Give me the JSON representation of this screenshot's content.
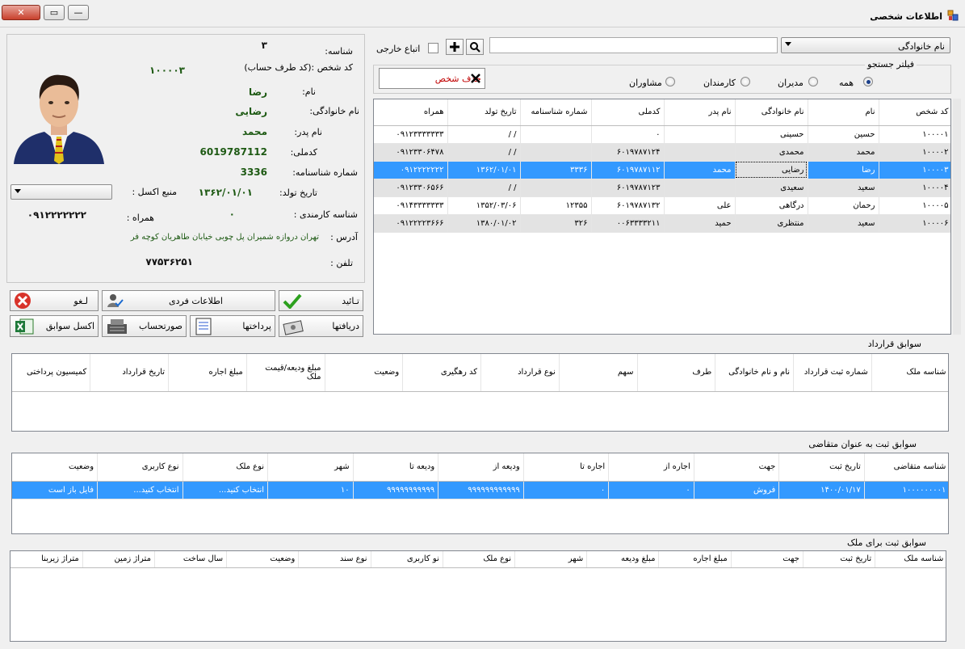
{
  "window": {
    "title": "اطلاعات شخصی",
    "close_label": "✕",
    "restore_label": "▭",
    "min_label": "—"
  },
  "search": {
    "field_combo": "نام خانوادگی",
    "query": "",
    "external_label": "اتباع خارجی",
    "filter_title": "فیلتر جستجو",
    "filters": [
      "همه",
      "مدیران",
      "کارمندان",
      "مشاوران"
    ],
    "selected_filter": "همه",
    "delete_person_label": "حذف شخص"
  },
  "person": {
    "labels": {
      "id": "شناسه:",
      "account": "کد شخص :(کد طرف حساب)",
      "first_name": "نام:",
      "last_name": "نام خانوادگی:",
      "father": "نام پدر:",
      "national_code": "کدملی:",
      "id_number": "شماره شناسنامه:",
      "birth": "تاریخ تولد:",
      "employee": "شناسه کارمندی :",
      "mobile": "همراه :",
      "address": "آدرس :",
      "phone": "تلفن :",
      "excel_source": "منبع اکسل :"
    },
    "id": "۳",
    "account": "۱۰۰۰۰۳",
    "first_name": "رضا",
    "last_name": "رضایی",
    "father": "محمد",
    "national_code": "6019787112",
    "id_number": "3336",
    "birth": "۱۳۶۲/۰۱/۰۱",
    "employee": "۰",
    "mobile": "۰۹۱۲۲۲۲۲۲۲",
    "address": "تهران دروازه شمیران پل چوبی خیابان طاهریان کوچه فر",
    "phone": "۷۷۵۳۶۲۵۱",
    "excel_source": ""
  },
  "actions": {
    "confirm": "تـائید",
    "individual_info": "اطلاعات فردی",
    "cancel": "لـغو",
    "receipts": "دریافتها",
    "payments": "پرداختها",
    "statement": "صورتحساب",
    "excel_history": "اکسل سوابق"
  },
  "people_grid": {
    "columns": [
      "کد شخص",
      "نام",
      "نام خانوادگی",
      "نام پدر",
      "کدملی",
      "شماره شناسنامه",
      "تاریخ تولد",
      "همراه"
    ],
    "rows": [
      [
        "۱۰۰۰۰۱",
        "حسین",
        "حسینی",
        "",
        "۰",
        "",
        "/ /",
        "۰۹۱۲۳۳۳۳۳۳۳"
      ],
      [
        "۱۰۰۰۰۲",
        "محمد",
        "محمدی",
        "",
        "۶۰۱۹۷۸۷۱۲۴",
        "",
        "/ /",
        "۰۹۱۲۳۳۰۶۴۷۸"
      ],
      [
        "۱۰۰۰۰۳",
        "رضا",
        "رضایی",
        "محمد",
        "۶۰۱۹۷۸۷۱۱۲",
        "۳۳۳۶",
        "۱۳۶۲/۰۱/۰۱",
        "۰۹۱۲۲۲۲۲۲۲"
      ],
      [
        "۱۰۰۰۰۴",
        "سعید",
        "سعیدی",
        "",
        "۶۰۱۹۷۸۷۱۲۳",
        "",
        "/ /",
        "۰۹۱۲۳۳۰۶۵۶۶"
      ],
      [
        "۱۰۰۰۰۵",
        "رحمان",
        "درگاهی",
        "علی",
        "۶۰۱۹۷۸۷۱۳۲",
        "۱۲۳۵۵",
        "۱۳۵۲/۰۳/۰۶",
        "۰۹۱۴۳۳۳۳۳۳۳"
      ],
      [
        "۱۰۰۰۰۶",
        "سعید",
        "منتظری",
        "حمید",
        "۰۰۶۳۳۳۳۲۱۱",
        "۳۲۶",
        "۱۳۸۰/۰۱/۰۲",
        "۰۹۱۲۲۲۲۳۶۶۶"
      ]
    ],
    "selected_row": 2
  },
  "contracts": {
    "title": "سوابق قرارداد",
    "columns": [
      "شناسه ملک",
      "شماره ثبت قرارداد",
      "نام و نام خانوادگی",
      "طرف",
      "سهم",
      "نوع قرارداد",
      "کد رهگیری",
      "وضعیت",
      "مبلغ ودیعه/قیمت ملک",
      "مبلغ اجاره",
      "تاریخ قرارداد",
      "کمیسیون پرداختی"
    ]
  },
  "applicant": {
    "title": "سوابق ثبت به عنوان متقاضی",
    "columns": [
      "شناسه متقاضی",
      "تاریخ ثبت",
      "جهت",
      "اجاره از",
      "اجاره تا",
      "ودیعه از",
      "ودیعه تا",
      "شهر",
      "نوع ملک",
      "نوع کاربری",
      "وضعیت"
    ],
    "rows": [
      [
        "۱۰۰۰۰۰۰۰۰۱",
        "۱۴۰۰/۰۱/۱۷",
        "فروش",
        "۰",
        "۰",
        "۹۹۹۹۹۹۹۹۹۹۹۹",
        "۹۹۹۹۹۹۹۹۹۹۹",
        "۱۰",
        "انتخاب کنید...",
        "انتخاب کنید...",
        "فایل باز است"
      ]
    ]
  },
  "property": {
    "title": "سوابق  ثبت برای ملک",
    "columns": [
      "شناسه ملک",
      "تاریخ ثبت",
      "جهت",
      "مبلغ اجاره",
      "مبلغ ودیعه",
      "شهر",
      "نوع ملک",
      "نو کاربری",
      "نوع سند",
      "وضعیت",
      "سال ساخت",
      "متراژ زمین",
      "متراژ زیربنا"
    ]
  },
  "colors": {
    "selection": "#3399ff",
    "value_green": "#1e5a14",
    "delete_red": "#c00000"
  }
}
